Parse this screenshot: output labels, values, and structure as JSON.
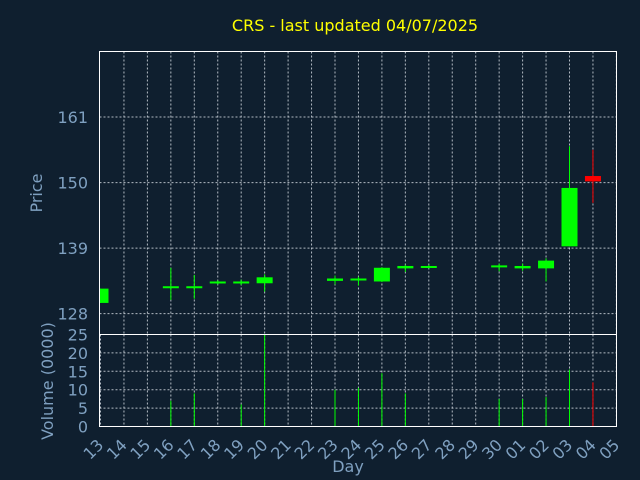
{
  "chart_data": {
    "type": "candlestick",
    "title": "CRS - last updated 04/07/2025",
    "xlabel": "Day",
    "price_panel": {
      "ylabel": "Price",
      "yticks": [
        128,
        139,
        150,
        161
      ],
      "ylim": [
        124.5,
        172.0
      ],
      "grid": true
    },
    "volume_panel": {
      "ylabel": "Volume (0000)",
      "yticks": [
        0,
        5,
        10,
        15,
        20,
        25
      ],
      "ylim": [
        0,
        25
      ],
      "grid": true
    },
    "x_ticks": [
      "13",
      "14",
      "15",
      "16",
      "17",
      "18",
      "19",
      "20",
      "21",
      "22",
      "23",
      "24",
      "25",
      "26",
      "27",
      "28",
      "29",
      "30",
      "01",
      "02",
      "03",
      "04",
      "05"
    ],
    "candles": [
      {
        "day": "13",
        "open": 129.8,
        "close": 132.2,
        "high": 132.2,
        "low": 129.8,
        "volume": 0,
        "direction": "up"
      },
      {
        "day": "16",
        "open": 132.4,
        "close": 132.6,
        "high": 135.7,
        "low": 130.3,
        "volume": 7,
        "direction": "up"
      },
      {
        "day": "17",
        "open": 132.3,
        "close": 132.6,
        "high": 134.5,
        "low": 130.5,
        "volume": 9,
        "direction": "up"
      },
      {
        "day": "18",
        "open": 133.1,
        "close": 133.4,
        "high": 133.6,
        "low": 132.9,
        "volume": 0,
        "direction": "up"
      },
      {
        "day": "19",
        "open": 133.2,
        "close": 133.4,
        "high": 133.7,
        "low": 132.8,
        "volume": 6,
        "direction": "up"
      },
      {
        "day": "20",
        "open": 133.1,
        "close": 134.1,
        "high": 134.6,
        "low": 131.7,
        "volume": 25,
        "direction": "up"
      },
      {
        "day": "23",
        "open": 133.5,
        "close": 133.9,
        "high": 134.4,
        "low": 132.9,
        "volume": 10,
        "direction": "up"
      },
      {
        "day": "24",
        "open": 133.6,
        "close": 133.9,
        "high": 134.2,
        "low": 132.7,
        "volume": 10.5,
        "direction": "up"
      },
      {
        "day": "25",
        "open": 133.4,
        "close": 135.7,
        "high": 135.8,
        "low": 133.3,
        "volume": 14.5,
        "direction": "up"
      },
      {
        "day": "26",
        "open": 135.6,
        "close": 136.0,
        "high": 136.2,
        "low": 135.0,
        "volume": 9,
        "direction": "up"
      },
      {
        "day": "27",
        "open": 135.7,
        "close": 136.0,
        "high": 136.2,
        "low": 135.6,
        "volume": 0,
        "direction": "up"
      },
      {
        "day": "30",
        "open": 135.8,
        "close": 136.1,
        "high": 136.4,
        "low": 135.1,
        "volume": 7.5,
        "direction": "up"
      },
      {
        "day": "01",
        "open": 135.6,
        "close": 136.0,
        "high": 136.4,
        "low": 135.2,
        "volume": 7.5,
        "direction": "up"
      },
      {
        "day": "02",
        "open": 135.6,
        "close": 136.9,
        "high": 137.3,
        "low": 133.4,
        "volume": 8,
        "direction": "up"
      },
      {
        "day": "03",
        "open": 139.3,
        "close": 149.1,
        "high": 156.1,
        "low": 139.3,
        "volume": 15.5,
        "direction": "up"
      },
      {
        "day": "04",
        "open": 151.1,
        "close": 150.2,
        "high": 155.5,
        "low": 146.6,
        "volume": 12,
        "direction": "down"
      }
    ],
    "colors": {
      "background": "#0f1f2f",
      "up": "#00ff00",
      "down": "#ff0000",
      "title": "#ffff00",
      "axis_text": "#7fa0c0",
      "frame": "#ffffff",
      "grid": "#cfd6dd"
    }
  }
}
